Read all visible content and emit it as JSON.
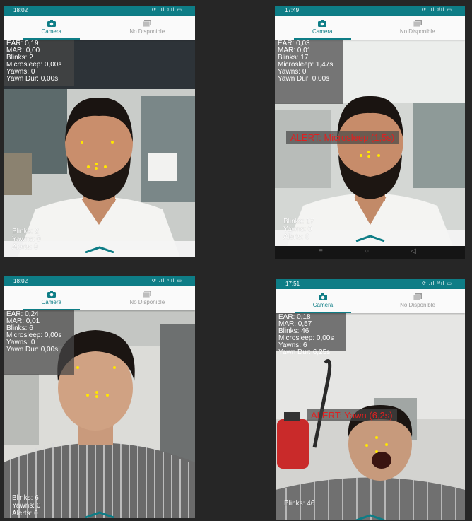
{
  "panels": [
    {
      "time": "18:02",
      "status_icons": "⟳ .ıl ᵃᴵıl ▭",
      "tabs": {
        "camera": "Camera",
        "unavailable": "No Disponible"
      },
      "overlay": [
        "EAR: 0,19",
        "MAR: 0,00",
        "Blinks: 2",
        "Microsleep: 0,00s",
        "Yawns: 0",
        "Yawn Dur: 0,00s"
      ],
      "bottom": [
        "Blinks: 2",
        "Yawns: 0",
        "Alerts: 0"
      ]
    },
    {
      "time": "17:49",
      "status_icons": "⟳ .ıl ᵃᴵıl ▭",
      "tabs": {
        "camera": "Camera",
        "unavailable": "No Disponible"
      },
      "overlay": [
        "EAR: 0,03",
        "MAR: 0,01",
        "Blinks: 17",
        "Microsleep: 1,47s",
        "Yawns: 0",
        "Yawn Dur: 0,00s"
      ],
      "alert": "ALERT: Microsleep (1,5s)",
      "bottom": [
        "Blinks: 17",
        "Yawns: 0",
        "Alerts: 0"
      ],
      "navbar": [
        "≡",
        "○",
        "◁"
      ]
    },
    {
      "time": "18:02",
      "status_icons": "⟳ .ıl ᵃᴵıl ▭",
      "tabs": {
        "camera": "Camera",
        "unavailable": "No Disponible"
      },
      "overlay": [
        "EAR: 0,24",
        "MAR: 0,01",
        "Blinks: 6",
        "Microsleep: 0,00s",
        "Yawns: 0",
        "Yawn Dur: 0,00s"
      ],
      "bottom": [
        "Blinks: 6",
        "Yawns: 0",
        "Alerts: 0"
      ]
    },
    {
      "time": "17:51",
      "status_icons": "⟳ .ıl ᵃᴵıl ▭",
      "tabs": {
        "camera": "Camera",
        "unavailable": "No Disponible"
      },
      "overlay": [
        "EAR: 0,18",
        "MAR: 0,57",
        "Blinks: 46",
        "Microsleep: 0,00s",
        "Yawns: 6",
        "Yawn Dur: 6,25s"
      ],
      "alert": "ALERT: Yawn (6,2s)",
      "bottom": [
        "Blinks: 46"
      ]
    }
  ],
  "colors": {
    "accent": "#0e7d86",
    "alert": "#e02020",
    "landmark": "#ffe600"
  }
}
